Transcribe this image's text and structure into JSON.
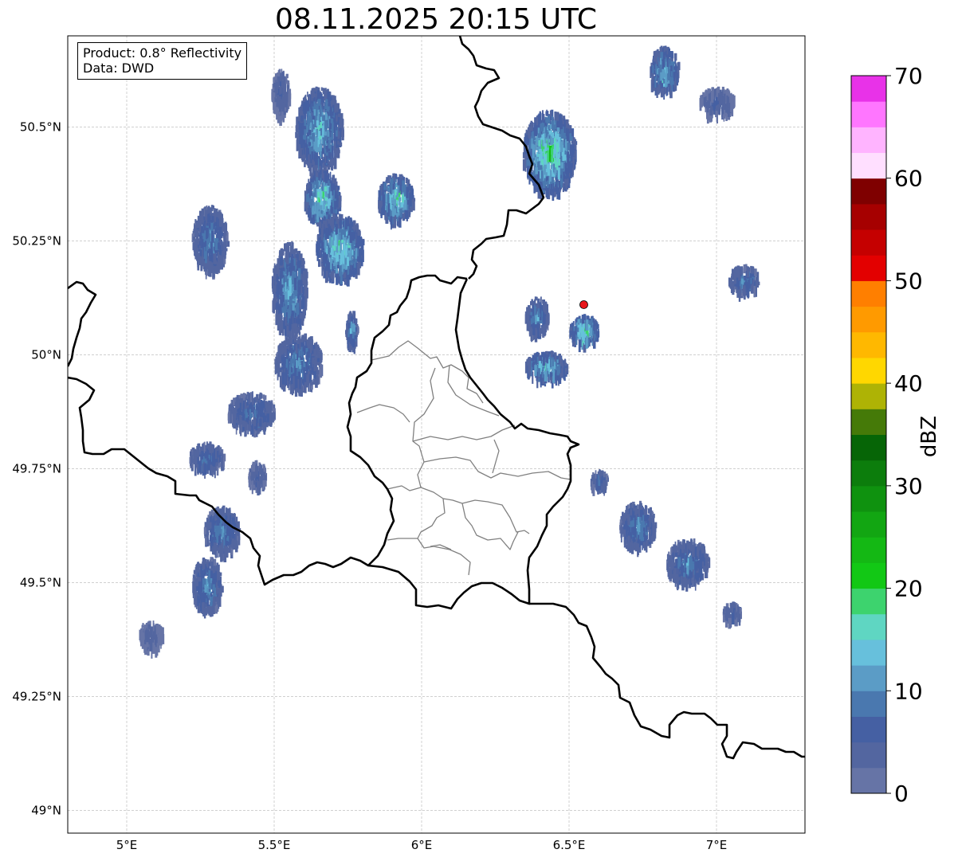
{
  "title": "08.11.2025 20:15 UTC",
  "info": {
    "product": "Product: 0.8° Reflectivity",
    "data": "Data: DWD"
  },
  "map": {
    "lon_range": [
      4.8,
      7.3
    ],
    "lat_range": [
      48.95,
      50.7
    ],
    "lon_ticks": [
      {
        "value": 5.0,
        "label": "5°E"
      },
      {
        "value": 5.5,
        "label": "5.5°E"
      },
      {
        "value": 6.0,
        "label": "6°E"
      },
      {
        "value": 6.5,
        "label": "6.5°E"
      },
      {
        "value": 7.0,
        "label": "7°E"
      }
    ],
    "lat_ticks": [
      {
        "value": 50.5,
        "label": "50.5°N"
      },
      {
        "value": 50.25,
        "label": "50.25°N"
      },
      {
        "value": 50.0,
        "label": "50°N"
      },
      {
        "value": 49.75,
        "label": "49.75°N"
      },
      {
        "value": 49.5,
        "label": "49.5°N"
      },
      {
        "value": 49.25,
        "label": "49.25°N"
      },
      {
        "value": 49.0,
        "label": "49°N"
      }
    ],
    "grid": true,
    "radar_site": {
      "lon": 6.55,
      "lat": 50.11,
      "color": "#e8161b"
    },
    "echo_regions": [
      {
        "lon": 5.65,
        "lat": 50.5,
        "rx": 0.08,
        "ry": 0.09,
        "max_dbz": 18
      },
      {
        "lon": 5.52,
        "lat": 50.58,
        "rx": 0.03,
        "ry": 0.05,
        "max_dbz": 8
      },
      {
        "lon": 5.66,
        "lat": 50.35,
        "rx": 0.06,
        "ry": 0.06,
        "max_dbz": 22
      },
      {
        "lon": 5.72,
        "lat": 50.24,
        "rx": 0.08,
        "ry": 0.07,
        "max_dbz": 22
      },
      {
        "lon": 5.55,
        "lat": 50.15,
        "rx": 0.06,
        "ry": 0.1,
        "max_dbz": 16
      },
      {
        "lon": 5.58,
        "lat": 49.99,
        "rx": 0.08,
        "ry": 0.06,
        "max_dbz": 14
      },
      {
        "lon": 5.76,
        "lat": 50.06,
        "rx": 0.02,
        "ry": 0.04,
        "max_dbz": 16
      },
      {
        "lon": 5.91,
        "lat": 50.35,
        "rx": 0.06,
        "ry": 0.05,
        "max_dbz": 22
      },
      {
        "lon": 5.28,
        "lat": 50.26,
        "rx": 0.06,
        "ry": 0.07,
        "max_dbz": 14
      },
      {
        "lon": 5.42,
        "lat": 49.88,
        "rx": 0.08,
        "ry": 0.04,
        "max_dbz": 12
      },
      {
        "lon": 5.27,
        "lat": 49.78,
        "rx": 0.06,
        "ry": 0.03,
        "max_dbz": 12
      },
      {
        "lon": 5.44,
        "lat": 49.74,
        "rx": 0.03,
        "ry": 0.03,
        "max_dbz": 8
      },
      {
        "lon": 5.32,
        "lat": 49.62,
        "rx": 0.06,
        "ry": 0.05,
        "max_dbz": 14
      },
      {
        "lon": 5.27,
        "lat": 49.5,
        "rx": 0.05,
        "ry": 0.06,
        "max_dbz": 14
      },
      {
        "lon": 5.08,
        "lat": 49.39,
        "rx": 0.04,
        "ry": 0.03,
        "max_dbz": 6
      },
      {
        "lon": 6.43,
        "lat": 50.45,
        "rx": 0.09,
        "ry": 0.09,
        "max_dbz": 24
      },
      {
        "lon": 6.82,
        "lat": 50.63,
        "rx": 0.05,
        "ry": 0.05,
        "max_dbz": 18
      },
      {
        "lon": 7.0,
        "lat": 50.56,
        "rx": 0.06,
        "ry": 0.03,
        "max_dbz": 8
      },
      {
        "lon": 6.39,
        "lat": 50.09,
        "rx": 0.04,
        "ry": 0.04,
        "max_dbz": 14
      },
      {
        "lon": 6.55,
        "lat": 50.06,
        "rx": 0.05,
        "ry": 0.03,
        "max_dbz": 24
      },
      {
        "lon": 6.42,
        "lat": 49.98,
        "rx": 0.07,
        "ry": 0.03,
        "max_dbz": 20
      },
      {
        "lon": 7.09,
        "lat": 50.17,
        "rx": 0.05,
        "ry": 0.03,
        "max_dbz": 14
      },
      {
        "lon": 6.73,
        "lat": 49.63,
        "rx": 0.06,
        "ry": 0.05,
        "max_dbz": 14
      },
      {
        "lon": 6.9,
        "lat": 49.55,
        "rx": 0.07,
        "ry": 0.05,
        "max_dbz": 14
      },
      {
        "lon": 7.05,
        "lat": 49.44,
        "rx": 0.03,
        "ry": 0.02,
        "max_dbz": 10
      },
      {
        "lon": 6.6,
        "lat": 49.73,
        "rx": 0.03,
        "ry": 0.02,
        "max_dbz": 10
      }
    ]
  },
  "colorbar": {
    "label": "dBZ",
    "min": 0,
    "max": 70,
    "step": 2.5,
    "ticks": [
      {
        "value": 0,
        "label": "0"
      },
      {
        "value": 10,
        "label": "10"
      },
      {
        "value": 20,
        "label": "20"
      },
      {
        "value": 30,
        "label": "30"
      },
      {
        "value": 40,
        "label": "40"
      },
      {
        "value": 50,
        "label": "50"
      },
      {
        "value": 60,
        "label": "60"
      },
      {
        "value": 70,
        "label": "70"
      }
    ],
    "colors": [
      "#6674a6",
      "#5366a0",
      "#4560a3",
      "#4a78af",
      "#5b9cc6",
      "#67c0dc",
      "#5fd6c2",
      "#3dd36e",
      "#12c815",
      "#14b814",
      "#12a612",
      "#0f920f",
      "#0c7d0c",
      "#066506",
      "#457a08",
      "#aeb305",
      "#ffd700",
      "#ffb800",
      "#ff9a00",
      "#ff7f00",
      "#e30000",
      "#c50000",
      "#a60000",
      "#7f0000",
      "#ffdfff",
      "#ffb4ff",
      "#ff76ff",
      "#e832e8"
    ]
  }
}
